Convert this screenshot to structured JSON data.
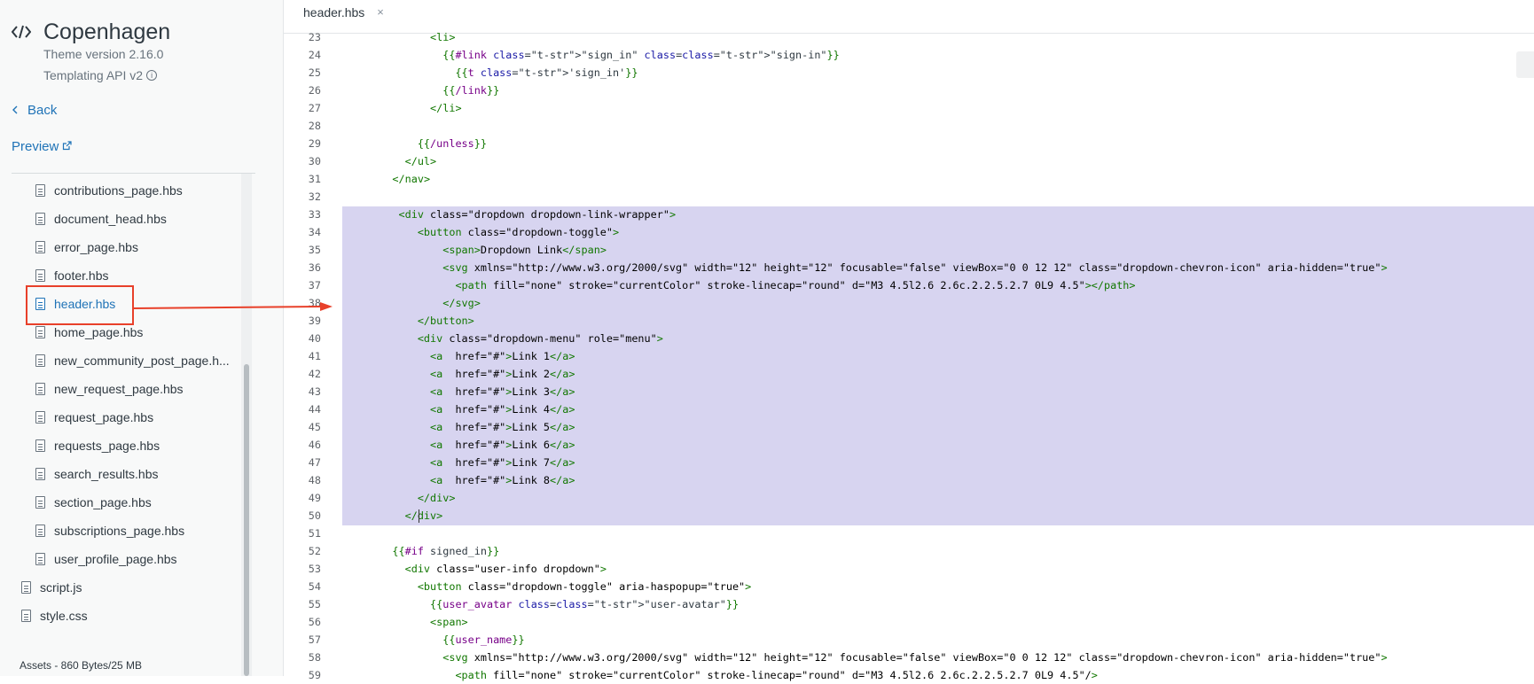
{
  "theme": {
    "name": "Copenhagen",
    "version": "Theme version 2.16.0",
    "api": "Templating API v2",
    "back_label": "Back",
    "preview_label": "Preview"
  },
  "files": [
    {
      "name": "contributions_page.hbs",
      "indent": true
    },
    {
      "name": "document_head.hbs",
      "indent": true
    },
    {
      "name": "error_page.hbs",
      "indent": true
    },
    {
      "name": "footer.hbs",
      "indent": true
    },
    {
      "name": "header.hbs",
      "indent": true,
      "active": true
    },
    {
      "name": "home_page.hbs",
      "indent": true
    },
    {
      "name": "new_community_post_page.h...",
      "indent": true
    },
    {
      "name": "new_request_page.hbs",
      "indent": true
    },
    {
      "name": "request_page.hbs",
      "indent": true
    },
    {
      "name": "requests_page.hbs",
      "indent": true
    },
    {
      "name": "search_results.hbs",
      "indent": true
    },
    {
      "name": "section_page.hbs",
      "indent": true
    },
    {
      "name": "subscriptions_page.hbs",
      "indent": true
    },
    {
      "name": "user_profile_page.hbs",
      "indent": true
    },
    {
      "name": "script.js",
      "indent": false
    },
    {
      "name": "style.css",
      "indent": false
    }
  ],
  "assets_label": "Assets - 860 Bytes/25 MB",
  "tab": {
    "label": "header.hbs",
    "close": "×"
  },
  "colors": {
    "accent": "#1f73b7",
    "selection": "#d7d4f0",
    "callout": "#e8402a"
  },
  "code": [
    {
      "n": "23",
      "text": "          <li>"
    },
    {
      "n": "24",
      "text": "            {{#link \"sign_in\" class=\"sign-in\"}}"
    },
    {
      "n": "25",
      "text": "              {{t 'sign_in'}}"
    },
    {
      "n": "26",
      "text": "            {{/link}}"
    },
    {
      "n": "27",
      "text": "          </li>"
    },
    {
      "n": "28",
      "text": ""
    },
    {
      "n": "29",
      "text": "        {{/unless}}"
    },
    {
      "n": "30",
      "text": "      </ul>"
    },
    {
      "n": "31",
      "text": "    </nav>"
    },
    {
      "n": "32",
      "text": ""
    },
    {
      "n": "33",
      "text": "     <div class=\"dropdown dropdown-link-wrapper\">"
    },
    {
      "n": "34",
      "text": "        <button class=\"dropdown-toggle\">"
    },
    {
      "n": "35",
      "text": "            <span>Dropdown Link</span>"
    },
    {
      "n": "36",
      "text": "            <svg xmlns=\"http://www.w3.org/2000/svg\" width=\"12\" height=\"12\" focusable=\"false\" viewBox=\"0 0 12 12\" class=\"dropdown-chevron-icon\" aria-hidden=\"true\">"
    },
    {
      "n": "37",
      "text": "              <path fill=\"none\" stroke=\"currentColor\" stroke-linecap=\"round\" d=\"M3 4.5l2.6 2.6c.2.2.5.2.7 0L9 4.5\"></path>"
    },
    {
      "n": "38",
      "text": "            </svg>"
    },
    {
      "n": "39",
      "text": "        </button>"
    },
    {
      "n": "40",
      "text": "        <div class=\"dropdown-menu\" role=\"menu\">"
    },
    {
      "n": "41",
      "text": "          <a  href=\"#\">Link 1</a>"
    },
    {
      "n": "42",
      "text": "          <a  href=\"#\">Link 2</a>"
    },
    {
      "n": "43",
      "text": "          <a  href=\"#\">Link 3</a>"
    },
    {
      "n": "44",
      "text": "          <a  href=\"#\">Link 4</a>"
    },
    {
      "n": "45",
      "text": "          <a  href=\"#\">Link 5</a>"
    },
    {
      "n": "46",
      "text": "          <a  href=\"#\">Link 6</a>"
    },
    {
      "n": "47",
      "text": "          <a  href=\"#\">Link 7</a>"
    },
    {
      "n": "48",
      "text": "          <a  href=\"#\">Link 8</a>"
    },
    {
      "n": "49",
      "text": "        </div>"
    },
    {
      "n": "50",
      "text": "      </div>"
    },
    {
      "n": "51",
      "text": ""
    },
    {
      "n": "52",
      "text": "    {{#if signed_in}}"
    },
    {
      "n": "53",
      "text": "      <div class=\"user-info dropdown\">"
    },
    {
      "n": "54",
      "text": "        <button class=\"dropdown-toggle\" aria-haspopup=\"true\">"
    },
    {
      "n": "55",
      "text": "          {{user_avatar class=\"user-avatar\"}}"
    },
    {
      "n": "56",
      "text": "          <span>"
    },
    {
      "n": "57",
      "text": "            {{user_name}}"
    },
    {
      "n": "58",
      "text": "            <svg xmlns=\"http://www.w3.org/2000/svg\" width=\"12\" height=\"12\" focusable=\"false\" viewBox=\"0 0 12 12\" class=\"dropdown-chevron-icon\" aria-hidden=\"true\">"
    },
    {
      "n": "59",
      "text": "              <path fill=\"none\" stroke=\"currentColor\" stroke-linecap=\"round\" d=\"M3 4.5l2.6 2.6c.2.2.5.2.7 0L9 4.5\"/>"
    }
  ]
}
